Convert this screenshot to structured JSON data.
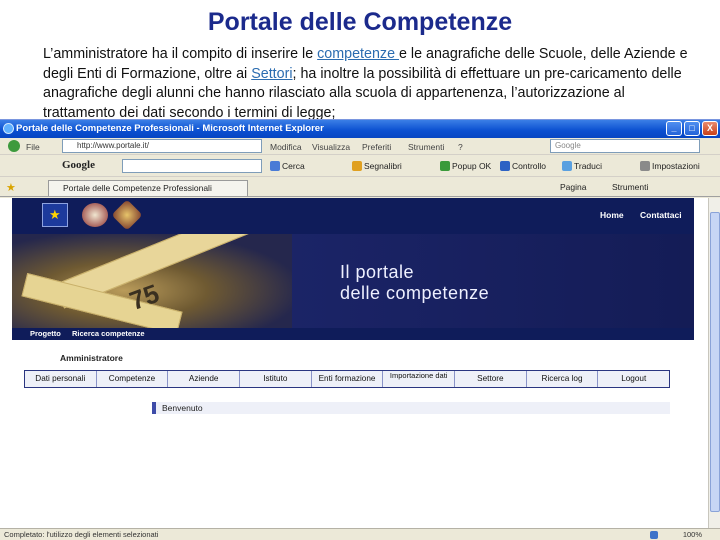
{
  "slide": {
    "title": "Portale delle Competenze",
    "text_before_link1": "L’amministratore ha il compito di inserire le ",
    "link1": "competenze ",
    "text_between_links": "e le anagrafiche delle Scuole, delle Aziende e degli Enti di Formazione, oltre ai ",
    "link2": "Settori",
    "text_after_link2": "; ha inoltre la possibilità di effettuare un pre-caricamento delle anagrafiche degli alunni che hanno rilasciato alla scuola di appartenenza, l’autorizzazione al trattamento dei dati secondo i termini di legge;"
  },
  "browser": {
    "window_title": "Portale delle Competenze Professionali - Microsoft Internet Explorer",
    "window_buttons": [
      "_",
      "□",
      "X"
    ],
    "menu": [
      "File",
      "Modifica",
      "Visualizza",
      "Preferiti",
      "Strumenti",
      "?"
    ],
    "address": "http://www.portale.it/",
    "search_placeholder": "Google",
    "toolbar": {
      "google_label": "Google",
      "cerca": "Cerca",
      "segnalibri": "Segnalibri",
      "popup": "Popup OK",
      "controllo": "Controllo",
      "traduci": "Traduci",
      "impostazioni": "Impostazioni"
    },
    "tab_title": "Portale delle Competenze Professionali",
    "tab_tools": {
      "pagina": "Pagina",
      "strumenti": "Strumenti"
    },
    "status_text": "Completato: l'utilizzo degli elementi selezionati",
    "zoom": "100%"
  },
  "site": {
    "header_links": [
      "Home",
      "Contattaci"
    ],
    "banner_line1": "Il portale",
    "banner_line2": "delle competenze",
    "banner_tape_number": "75",
    "breadcrumb": [
      "Progetto",
      "Ricerca competenze"
    ],
    "admin_label": "Amministratore",
    "nav": [
      "Dati personali",
      "Competenze",
      "Aziende",
      "Istituto",
      "Enti formazione",
      "Importazione dati",
      "Settore",
      "Ricerca log",
      "Logout"
    ],
    "welcome": "Benvenuto"
  },
  "colors": {
    "title": "#1b2a8c",
    "site_navy": "#0f1c5a",
    "xp_titlebar": "#0a4fd0"
  }
}
